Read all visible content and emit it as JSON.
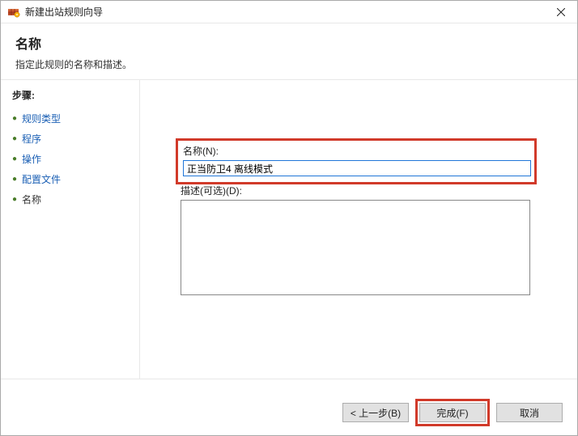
{
  "window": {
    "title": "新建出站规则向导"
  },
  "header": {
    "title": "名称",
    "subtitle": "指定此规则的名称和描述。"
  },
  "sidebar": {
    "steps_label": "步骤:",
    "items": [
      {
        "label": "规则类型",
        "current": false
      },
      {
        "label": "程序",
        "current": false
      },
      {
        "label": "操作",
        "current": false
      },
      {
        "label": "配置文件",
        "current": false
      },
      {
        "label": "名称",
        "current": true
      }
    ]
  },
  "form": {
    "name_label": "名称(N):",
    "name_value": "正当防卫4 离线模式",
    "desc_label": "描述(可选)(D):",
    "desc_value": ""
  },
  "footer": {
    "back": "< 上一步(B)",
    "finish": "完成(F)",
    "cancel": "取消"
  }
}
